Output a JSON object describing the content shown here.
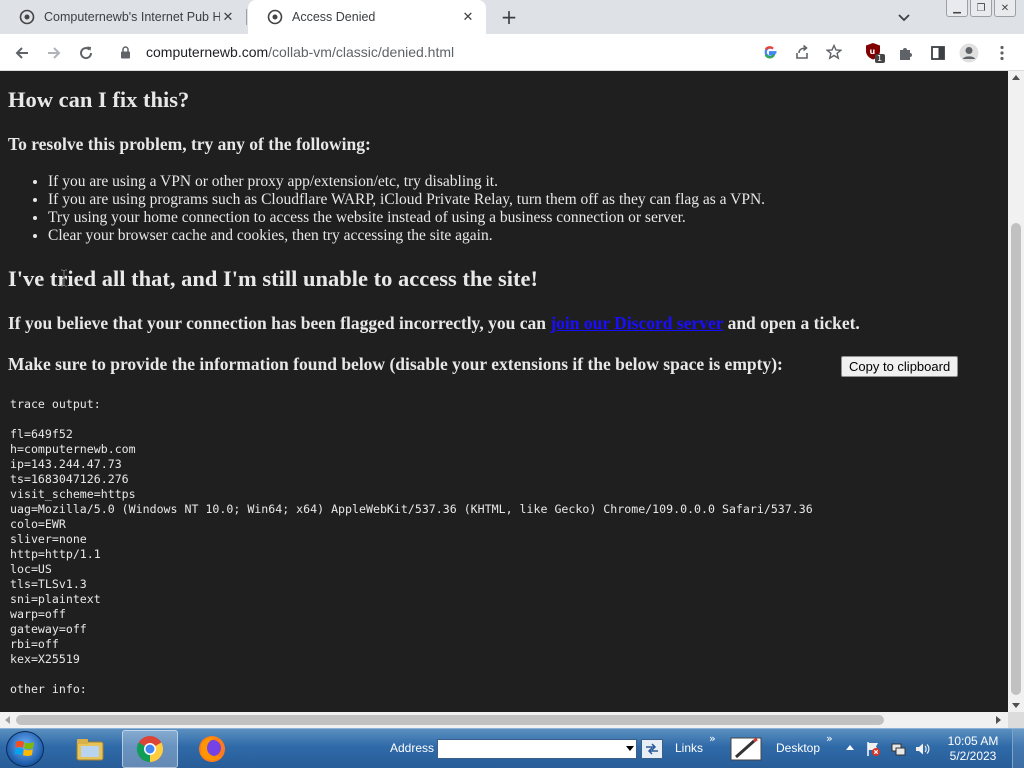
{
  "browser": {
    "tabs": [
      {
        "title": "Computernewb's Internet Pub Hu",
        "active": false
      },
      {
        "title": "Access Denied",
        "active": true
      }
    ],
    "url_host": "computernewb.com",
    "url_path": "/collab-vm/classic/denied.html",
    "extension_badge": "1"
  },
  "page": {
    "heading_fix": "How can I fix this?",
    "subheading_resolve": "To resolve this problem, try any of the following:",
    "tips": [
      "If you are using a VPN or other proxy app/extension/etc, try disabling it.",
      "If you are using programs such as Cloudflare WARP, iCloud Private Relay, turn them off as they can flag as a VPN.",
      "Try using your home connection to access the website instead of using a business connection or server.",
      "Clear your browser cache and cookies, then try accessing the site again."
    ],
    "heading_tried": "I've tried all that, and I'm still unable to access the site!",
    "flagged_before": "If you believe that your connection has been flagged incorrectly, you can ",
    "flagged_link": "join our Discord server",
    "flagged_after": " and open a ticket.",
    "provide_info": "Make sure to provide the information found below (disable your extensions if the below space is empty):",
    "copy_button": "Copy to clipboard",
    "trace_text": "trace output:\n\nfl=649f52\nh=computernewb.com\nip=143.244.47.73\nts=1683047126.276\nvisit_scheme=https\nuag=Mozilla/5.0 (Windows NT 10.0; Win64; x64) AppleWebKit/537.36 (KHTML, like Gecko) Chrome/109.0.0.0 Safari/537.36\ncolo=EWR\nsliver=none\nhttp=http/1.1\nloc=US\ntls=TLSv1.3\nsni=plaintext\nwarp=off\ngateway=off\nrbi=off\nkex=X25519\n\nother info:"
  },
  "taskbar": {
    "address_label": "Address",
    "address_value": "",
    "links_label": "Links",
    "desktop_label": "Desktop",
    "time": "10:05 AM",
    "date": "5/2/2023"
  },
  "colors": {
    "page_background": "#1f1f1f",
    "page_text": "#e8e8e8",
    "link": "#1a0dff",
    "tab_strip": "#dee1e6"
  }
}
